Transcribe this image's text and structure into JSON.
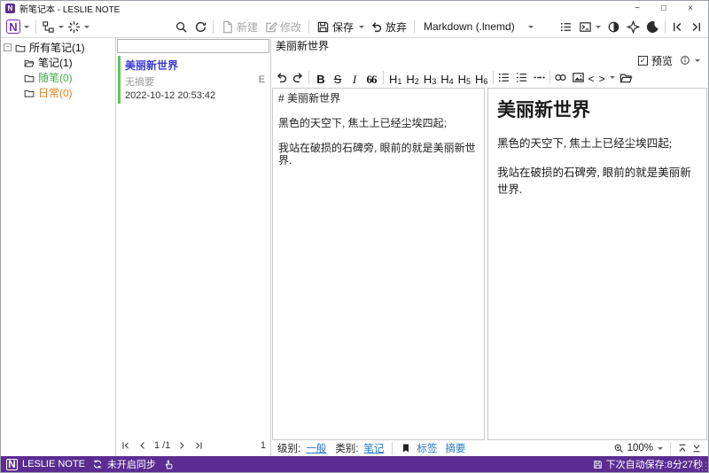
{
  "window": {
    "title": "新笔记本 - LESLIE NOTE"
  },
  "window_controls": {
    "minimize": "−",
    "maximize": "□",
    "close": "×"
  },
  "toolbar": {
    "new_label": "新建",
    "modify_label": "修改",
    "save_label": "保存",
    "discard_label": "放弃",
    "format_value": "Markdown (.lnemd)"
  },
  "tree": {
    "items": [
      {
        "label": "所有笔记(1)"
      },
      {
        "label": "笔记(1)"
      },
      {
        "label": "随笔(0)"
      },
      {
        "label": "日常(0)"
      }
    ]
  },
  "list": {
    "search_value": "",
    "note": {
      "title": "美丽新世界",
      "summary": "无摘要",
      "date": "2022-10-12 20:53:42",
      "marker": "E"
    },
    "pagination": {
      "page": "1",
      "of": "/1"
    },
    "count": "1"
  },
  "editor": {
    "title": "美丽新世界",
    "preview_label": "预览",
    "md_toolbar": {
      "bold": "B",
      "strike": "S",
      "italic": "I",
      "quote": "66",
      "h_letter": "H",
      "h_nums": [
        "1",
        "2",
        "3",
        "4",
        "5",
        "6"
      ],
      "code": "< >"
    },
    "source_lines": [
      "# 美丽新世界",
      "",
      "黑色的天空下, 焦土上已经尘埃四起;",
      "",
      "我站在破损的石碑旁, 眼前的就是美丽新世界."
    ],
    "preview": {
      "heading": "美丽新世界",
      "paragraphs": [
        "黑色的天空下, 焦土上已经尘埃四起;",
        "我站在破损的石碑旁, 眼前的就是美丽新世界."
      ]
    },
    "footer": {
      "level_label": "级别:",
      "level_value": "一般",
      "category_label": "类别:",
      "category_value": "笔记",
      "tags_label": "标签",
      "summary_label": "摘要",
      "zoom": "100%"
    }
  },
  "status": {
    "app_name": "LESLIE NOTE",
    "sync_text": "未开启同步",
    "autosave_text": "下次自动保存:8分27秒"
  },
  "logo_letter": "N",
  "colors": {
    "accent_purple": "#5b2d91",
    "note_title_blue": "#3a3ad0",
    "link_blue": "#2878c8",
    "tag_green": "#3fae49",
    "tag_orange": "#e8801e",
    "note_bar_green": "#5cc75c"
  },
  "icons": {
    "named": [
      "app-logo",
      "hierarchy-icon",
      "spinner-icon",
      "search-icon",
      "refresh-icon",
      "new-doc-icon",
      "edit-icon",
      "save-icon",
      "discard-undo-icon",
      "list-view-icon",
      "console-icon",
      "contrast-icon",
      "pin-star-icon",
      "moon-icon",
      "collapse-left-icon",
      "collapse-right-icon",
      "folder-icon",
      "folder-open-icon",
      "undo-icon",
      "redo-icon",
      "bullet-list-icon",
      "ordered-list-icon",
      "hr-icon",
      "link-icon",
      "image-icon",
      "open-file-icon",
      "preview-checkbox",
      "info-icon",
      "bookmark-icon",
      "zoom-in-icon",
      "scroll-top-icon",
      "scroll-bottom-icon",
      "sync-icon",
      "hand-icon",
      "floppy-icon",
      "first-page-icon",
      "prev-page-icon",
      "next-page-icon",
      "last-page-icon"
    ]
  }
}
